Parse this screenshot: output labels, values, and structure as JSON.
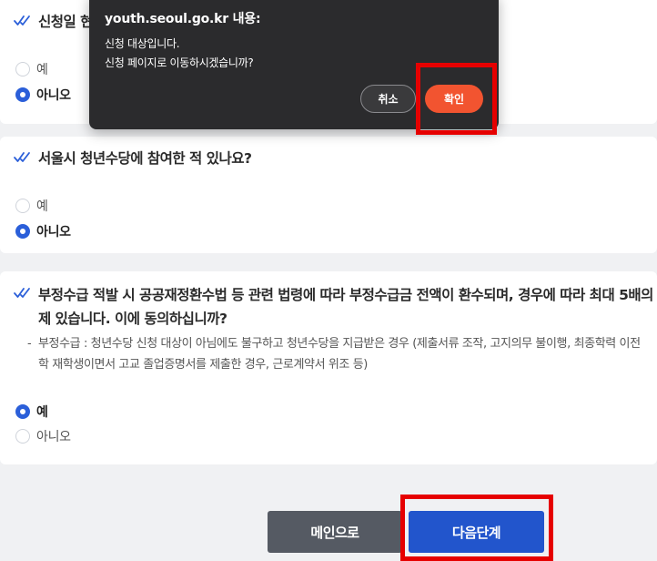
{
  "questions": [
    {
      "text": "신청일 현",
      "options": [
        "예",
        "아니오"
      ],
      "selected": 1
    },
    {
      "text": "서울시 청년수당에 참여한 적 있나요?",
      "options": [
        "예",
        "아니오"
      ],
      "selected": 1
    },
    {
      "text": "부정수급 적발 시 공공재정환수법 등 관련 법령에 따라 부정수급금 전액이 환수되며, 경우에 따라 최대 5배의 제 있습니다. 이에 동의하십니까?",
      "note_dash": "-",
      "note_line1": "부정수급 : 청년수당 신청 대상이 아님에도 불구하고 청년수당을 지급받은 경우 (제출서류 조작, 고지의무 불이행, 최종학력 이전",
      "note_line2": "학 재학생이면서 고교 졸업증명서를 제출한 경우, 근로계약서 위조 등)",
      "options": [
        "예",
        "아니오"
      ],
      "selected": 0
    }
  ],
  "buttons": {
    "main": "메인으로",
    "next": "다음단계"
  },
  "dialog": {
    "title": "youth.seoul.go.kr 내용:",
    "message_line1": "신청 대상입니다.",
    "message_line2": "신청 페이지로 이동하시겠습니까?",
    "cancel": "취소",
    "confirm": "확인"
  },
  "colors": {
    "background": "#f0f1f3",
    "check_accent": "#2b5fd9",
    "main_button": "#555a63",
    "next_button": "#2255cc",
    "dialog_bg": "#2b2b2d",
    "confirm_button": "#f25430",
    "highlight_box": "#e60000"
  },
  "icons": {
    "question_marker": "double-check-icon"
  }
}
